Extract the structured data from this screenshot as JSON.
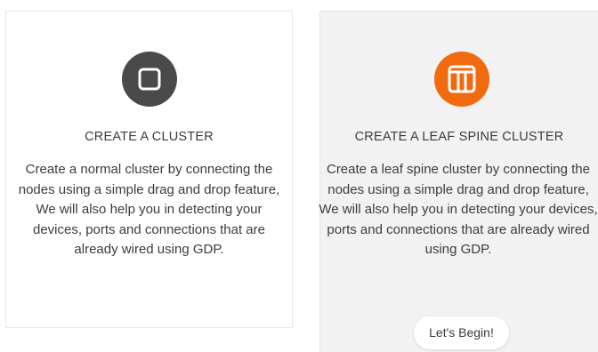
{
  "cards": [
    {
      "title": "CREATE A CLUSTER",
      "description": "Create a normal cluster by connecting the nodes using a simple drag and drop feature, We will also help you in detecting your devices, ports and connections that are already wired using GDP.",
      "icon": "square-icon",
      "icon_color": "#4a4a4a"
    },
    {
      "title": "CREATE A LEAF SPINE CLUSTER",
      "description": "Create a leaf spine cluster by connecting the nodes using a simple drag and drop feature, We will also help you in detecting your devices, ports and connections that are already wired using GDP.",
      "icon": "leaf-spine-icon",
      "icon_color": "#f26a0f",
      "button_label": "Let's Begin!"
    }
  ]
}
